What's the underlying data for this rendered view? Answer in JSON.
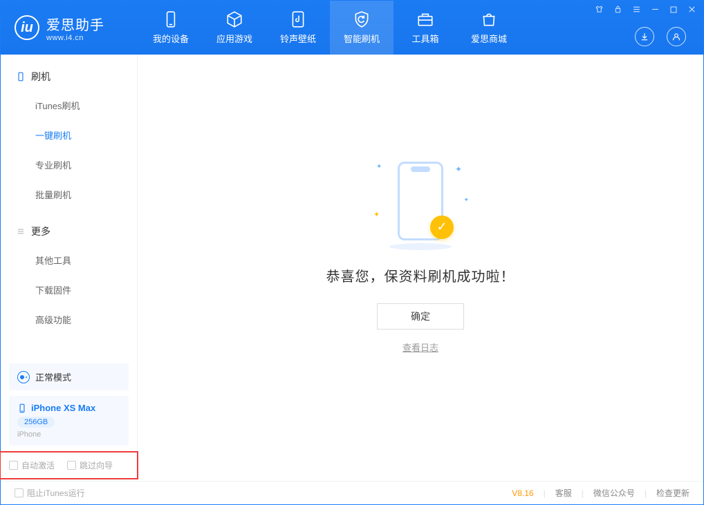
{
  "app": {
    "name_cn": "爱思助手",
    "name_en": "www.i4.cn"
  },
  "nav": {
    "items": [
      {
        "label": "我的设备"
      },
      {
        "label": "应用游戏"
      },
      {
        "label": "铃声壁纸"
      },
      {
        "label": "智能刷机"
      },
      {
        "label": "工具箱"
      },
      {
        "label": "爱思商城"
      }
    ]
  },
  "sidebar": {
    "section1": {
      "title": "刷机",
      "items": [
        "iTunes刷机",
        "一键刷机",
        "专业刷机",
        "批量刷机"
      ]
    },
    "section2": {
      "title": "更多",
      "items": [
        "其他工具",
        "下载固件",
        "高级功能"
      ]
    },
    "mode": "正常模式",
    "device": {
      "name": "iPhone XS Max",
      "storage": "256GB",
      "type": "iPhone"
    },
    "checks": {
      "auto_activate": "自动激活",
      "skip_guide": "跳过向导"
    }
  },
  "main": {
    "success": "恭喜您，保资料刷机成功啦！",
    "ok": "确定",
    "view_log": "查看日志"
  },
  "footer": {
    "block_itunes": "阻止iTunes运行",
    "version": "V8.16",
    "links": [
      "客服",
      "微信公众号",
      "检查更新"
    ]
  }
}
